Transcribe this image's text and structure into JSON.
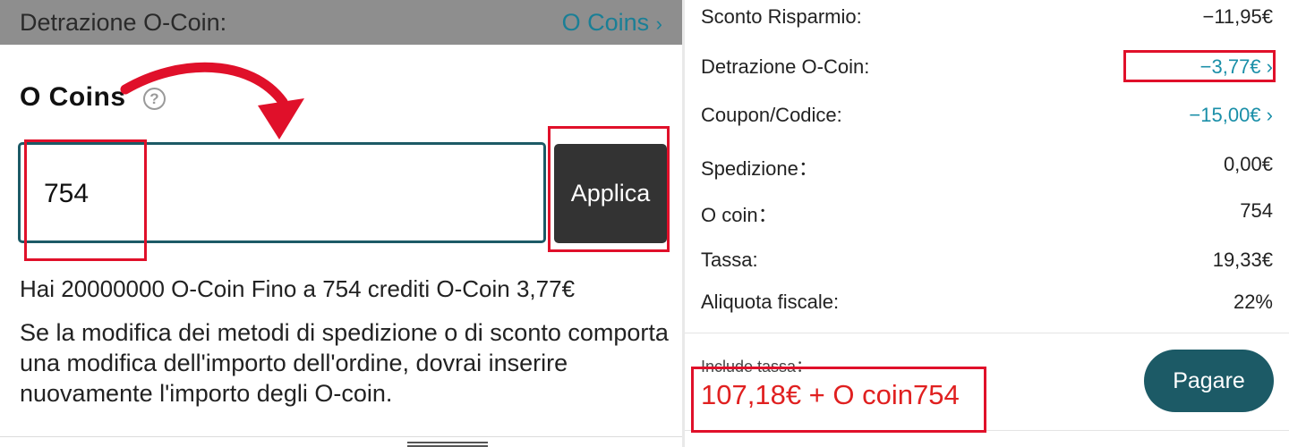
{
  "left": {
    "header": {
      "label": "Detrazione O-Coin:",
      "value": "O Coins"
    },
    "title": "O Coins",
    "help_glyph": "?",
    "input": {
      "value": "754"
    },
    "apply_label": "Applica",
    "info_line": "Hai 20000000 O-Coin Fino a 754 crediti O-Coin 3,77€",
    "notice": "Se la modifica dei metodi di spedizione o di sconto comporta una modifica dell'importo dell'ordine, dovrai inserire nuovamente l'importo degli O-coin."
  },
  "summary": {
    "rows": [
      {
        "label": "Sconto Risparmio:",
        "value": "−11,95€"
      },
      {
        "label": "Detrazione O-Coin:",
        "value": "−3,77€"
      },
      {
        "label": "Coupon/Codice:",
        "value": "−15,00€"
      },
      {
        "label": "Spedizione：",
        "value": "0,00€"
      },
      {
        "label": "O coin：",
        "value": "754"
      },
      {
        "label": "Tassa:",
        "value": "19,33€"
      },
      {
        "label": "Aliquota fiscale:",
        "value": "22%"
      }
    ],
    "tax_note": "Include tassa：",
    "total": "107,18€ + O coin754",
    "pay_label": "Pagare"
  },
  "colors": {
    "accent": "#1c5a66",
    "link": "#1a8fa8",
    "highlight": "#e0102a",
    "total_text": "#e02020"
  },
  "icons": {
    "chevron": "chevron-right-icon",
    "help": "question-circle-icon",
    "annotation": "curved-arrow-icon"
  }
}
